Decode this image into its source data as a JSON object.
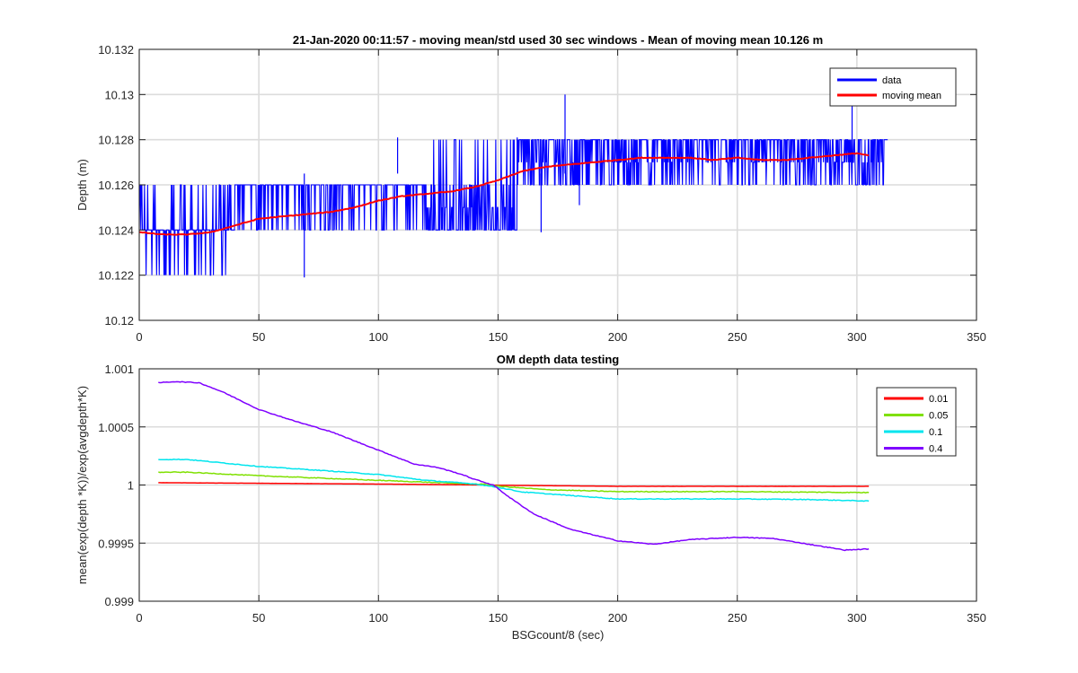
{
  "chart_data": [
    {
      "type": "line",
      "title": "21-Jan-2020 00:11:57 - moving mean/std used 30 sec windows - Mean of moving mean 10.126 m",
      "xlabel": "",
      "ylabel": "Depth (m)",
      "xlim": [
        0,
        350
      ],
      "ylim": [
        10.12,
        10.132
      ],
      "xticks": [
        0,
        50,
        100,
        150,
        200,
        250,
        300,
        350
      ],
      "xtick_labels": [
        "0",
        "50",
        "100",
        "150",
        "200",
        "250",
        "300",
        "350"
      ],
      "yticks": [
        10.12,
        10.122,
        10.124,
        10.126,
        10.128,
        10.13,
        10.132
      ],
      "ytick_labels": [
        "10.12",
        "10.122",
        "10.124",
        "10.126",
        "10.128",
        "10.13",
        "10.132"
      ],
      "grid": true,
      "legend_position": "top-right",
      "series": [
        {
          "name": "data",
          "color": "#0000ff",
          "style": "dense-noise",
          "x_range": [
            0,
            313
          ],
          "segments": [
            {
              "x": [
                0,
                40
              ],
              "levels": [
                10.124,
                10.122,
                10.126
              ],
              "base": 10.124,
              "extra_points": [
                [
                  14,
                  10.1219
                ],
                [
                  25,
                  10.1219
                ],
                [
                  60,
                  10.1219
                ]
              ]
            },
            {
              "x": [
                40,
                120
              ],
              "levels": [
                10.124,
                10.126
              ],
              "base": 10.126
            },
            {
              "x": [
                120,
                158
              ],
              "levels": [
                10.124,
                10.126,
                10.128
              ],
              "base": 10.125
            },
            {
              "x": [
                158,
                313
              ],
              "levels": [
                10.126,
                10.128
              ],
              "base": 10.127
            }
          ],
          "spikes": [
            [
              69,
              10.1219
            ],
            [
              108,
              10.1281
            ],
            [
              158,
              10.1281
            ],
            [
              168,
              10.1239
            ],
            [
              178,
              10.13
            ],
            [
              184,
              10.1251
            ],
            [
              298,
              10.1299
            ]
          ]
        },
        {
          "name": "moving mean",
          "color": "#ff0000",
          "x": [
            0,
            10,
            20,
            30,
            40,
            50,
            60,
            70,
            80,
            90,
            100,
            110,
            120,
            130,
            140,
            150,
            160,
            170,
            180,
            190,
            200,
            210,
            220,
            230,
            240,
            250,
            260,
            270,
            280,
            290,
            300,
            305
          ],
          "y": [
            10.1239,
            10.1238,
            10.1238,
            10.1239,
            10.1242,
            10.1245,
            10.1246,
            10.1247,
            10.1248,
            10.125,
            10.1253,
            10.1255,
            10.1256,
            10.1257,
            10.1259,
            10.1262,
            10.1266,
            10.1268,
            10.1269,
            10.127,
            10.1271,
            10.1272,
            10.1272,
            10.1272,
            10.1271,
            10.1272,
            10.1271,
            10.1271,
            10.1272,
            10.1273,
            10.1274,
            10.1273
          ]
        }
      ]
    },
    {
      "type": "line",
      "title": "OM depth data testing",
      "xlabel": "BSGcount/8 (sec)",
      "ylabel": "mean(exp(depth *K))/exp(avgdepth*K)",
      "xlim": [
        0,
        350
      ],
      "ylim": [
        0.999,
        1.001
      ],
      "xticks": [
        0,
        50,
        100,
        150,
        200,
        250,
        300,
        350
      ],
      "xtick_labels": [
        "0",
        "50",
        "100",
        "150",
        "200",
        "250",
        "300",
        "350"
      ],
      "yticks": [
        0.999,
        0.9995,
        1,
        1.0005,
        1.001
      ],
      "ytick_labels": [
        "0.999",
        "0.9995",
        "1",
        "1.0005",
        "1.001"
      ],
      "grid": true,
      "legend_position": "top-right",
      "series": [
        {
          "name": "0.01",
          "color": "#ff0000",
          "x": [
            8,
            50,
            100,
            145,
            150,
            200,
            250,
            305
          ],
          "y": [
            1.00002,
            1.000015,
            1.000008,
            1.0000005,
            0.999998,
            0.999989,
            0.999989,
            0.999989
          ]
        },
        {
          "name": "0.05",
          "color": "#7fe000",
          "x": [
            8,
            20,
            50,
            100,
            145,
            150,
            170,
            200,
            250,
            305
          ],
          "y": [
            1.00011,
            1.00011,
            1.00008,
            1.00004,
            1.000005,
            0.99999,
            0.99996,
            0.999943,
            0.999943,
            0.999935
          ]
        },
        {
          "name": "0.1",
          "color": "#00e5ee",
          "x": [
            8,
            20,
            30,
            50,
            80,
            100,
            120,
            140,
            150,
            160,
            180,
            200,
            220,
            250,
            280,
            305
          ],
          "y": [
            1.00022,
            1.00022,
            1.0002,
            1.00016,
            1.00012,
            1.00009,
            1.00004,
            1.00001,
            0.99998,
            0.99994,
            0.99991,
            0.99988,
            0.99988,
            0.99988,
            0.999875,
            0.999862
          ]
        },
        {
          "name": "0.4",
          "color": "#7f00ff",
          "x": [
            8,
            15,
            25,
            35,
            50,
            65,
            80,
            95,
            105,
            115,
            125,
            135,
            140,
            148,
            155,
            165,
            180,
            200,
            215,
            230,
            250,
            265,
            280,
            295,
            305
          ],
          "y": [
            1.00088,
            1.00089,
            1.00088,
            1.0008,
            1.00065,
            1.00055,
            1.00046,
            1.00034,
            1.00026,
            1.00018,
            1.00015,
            1.00009,
            1.00005,
            1.0,
            0.99989,
            0.99975,
            0.99962,
            0.99952,
            0.99949,
            0.99953,
            0.99955,
            0.99954,
            0.99949,
            0.99944,
            0.99945
          ]
        }
      ]
    }
  ]
}
